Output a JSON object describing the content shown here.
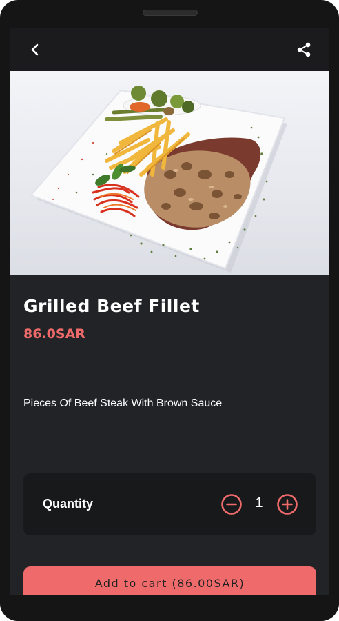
{
  "header": {
    "back_icon": "chevron-left-icon",
    "share_icon": "share-icon"
  },
  "product": {
    "name": "Grilled Beef Fillet",
    "price": "86.0SAR",
    "description": "Pieces Of Beef Steak With Brown Sauce"
  },
  "quantity": {
    "label": "Quantity",
    "value": "1",
    "minus_icon": "minus-circle-icon",
    "plus_icon": "plus-circle-icon"
  },
  "cart": {
    "button_label": "Add to cart (86.00SAR)"
  },
  "colors": {
    "accent": "#ef6a6a",
    "background": "#222326",
    "card": "#18191b",
    "topbar": "#1b1b1d"
  }
}
